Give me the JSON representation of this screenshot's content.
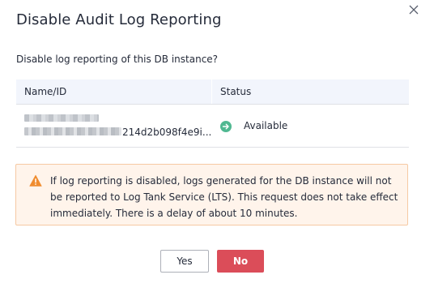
{
  "dialog": {
    "title": "Disable Audit Log Reporting",
    "question": "Disable log reporting of this DB instance?"
  },
  "table": {
    "headers": {
      "name_id": "Name/ID",
      "status": "Status"
    },
    "rows": [
      {
        "id_suffix": "214d2b098f4e9i...",
        "status": "Available"
      }
    ]
  },
  "alert": {
    "text": "If log reporting is disabled, logs generated for the DB instance will not be reported to Log Tank Service (LTS). This request does not take effect immediately. There is a delay of about 10 minutes."
  },
  "buttons": {
    "yes": "Yes",
    "no": "No"
  },
  "colors": {
    "primary_danger": "#db4d59",
    "status_ok": "#50b891",
    "warning": "#f08c2f",
    "alert_bg": "#fff4eb",
    "header_bg": "#f2f5fc"
  },
  "icons": {
    "close": "close-icon",
    "status": "arrow-right-circle-icon",
    "warning": "warning-triangle-icon"
  }
}
